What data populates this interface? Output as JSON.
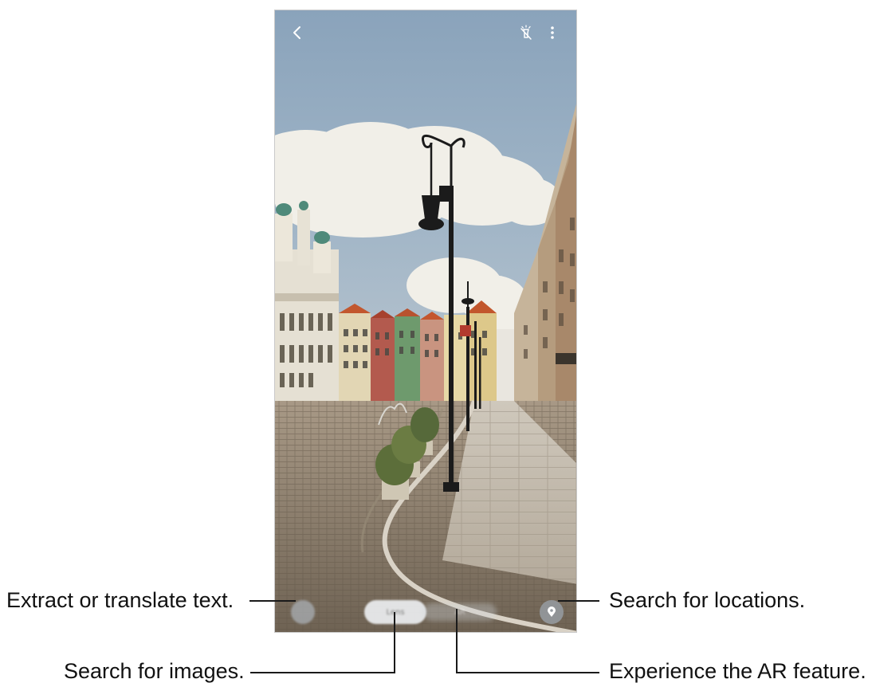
{
  "screen": {
    "camera_view": "street-scene"
  },
  "topbar": {
    "back_icon": "chevron-left-icon",
    "flash_icon": "flash-off-icon",
    "more_icon": "more-vertical-icon"
  },
  "modes": {
    "text_icon": "text-mode-icon",
    "lens_label": "Lens",
    "ar_label": "AR",
    "location_icon": "location-pin-icon"
  },
  "callouts": {
    "text": "Extract or translate text.",
    "images": "Search for images.",
    "ar": "Experience the AR feature.",
    "locations": "Search for locations."
  },
  "colors": {
    "sky": "#8fa6bd",
    "cloud": "#f2f0ea",
    "cobblestone": "#8a7d6d",
    "pavement": "#c9c2b6",
    "lamp": "#1b1b1b"
  }
}
